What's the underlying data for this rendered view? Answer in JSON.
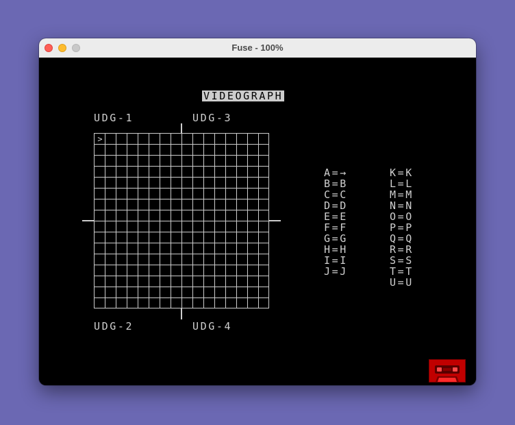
{
  "window": {
    "title": "Fuse - 100%"
  },
  "screen": {
    "heading": "VIDEOGRAPH",
    "cursor_glyph": ">",
    "udg_labels": {
      "top_left": "UDG-1",
      "top_right": "UDG-3",
      "bottom_left": "UDG-2",
      "bottom_right": "UDG-4"
    },
    "grid": {
      "rows": 16,
      "columns": 16
    },
    "key_map_left": [
      "A=→",
      "B=B",
      "C=C",
      "D=D",
      "E=E",
      "F=F",
      "G=G",
      "H=H",
      "I=I",
      "J=J"
    ],
    "key_map_right": [
      "K=K",
      "L=L",
      "M=M",
      "N=N",
      "O=O",
      "P=P",
      "Q=Q",
      "R=R",
      "S=S",
      "T=T",
      "U=U"
    ]
  },
  "tape_indicator": {
    "icon": "cassette-tape-icon",
    "color": "#c00000"
  },
  "colors": {
    "desktop": "#6b68b3",
    "screen_paper": "#000000",
    "screen_ink": "#cdcdcd"
  }
}
